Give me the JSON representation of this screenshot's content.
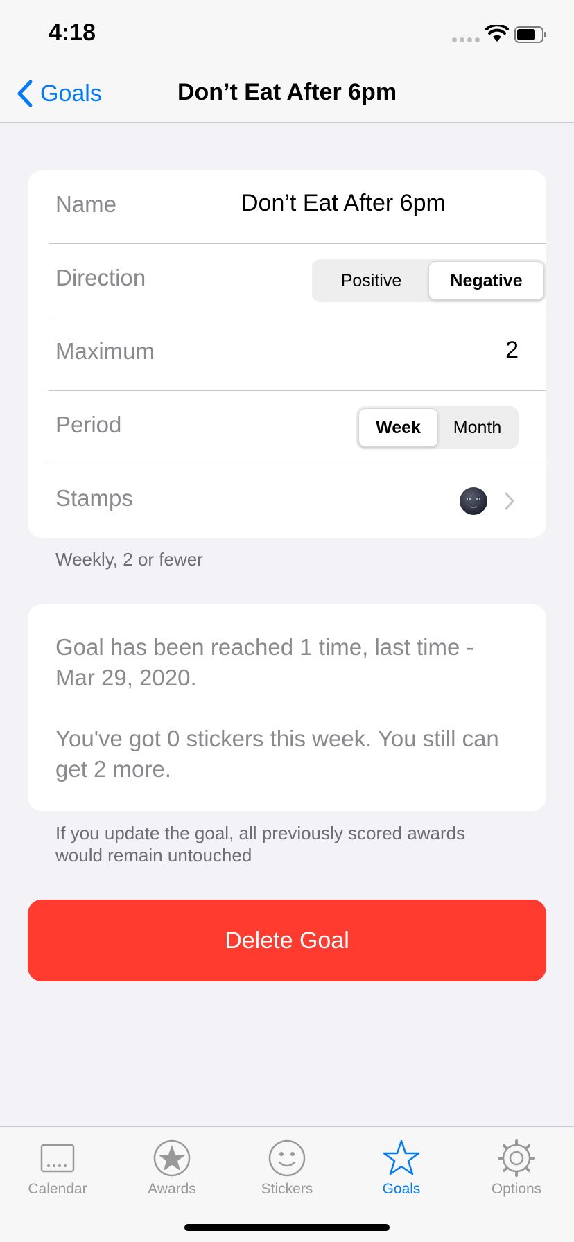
{
  "status": {
    "time": "4:18"
  },
  "nav": {
    "back_label": "Goals",
    "title": "Don’t Eat After 6pm"
  },
  "form": {
    "name_label": "Name",
    "name_value": "Don’t Eat After 6pm",
    "direction_label": "Direction",
    "direction_options": [
      "Positive",
      "Negative"
    ],
    "direction_selected": "Negative",
    "maximum_label": "Maximum",
    "maximum_value": "2",
    "period_label": "Period",
    "period_options": [
      "Week",
      "Month"
    ],
    "period_selected": "Week",
    "stamps_label": "Stamps",
    "stamp_icon": "new-moon-face-icon"
  },
  "form_footer": "Weekly, 2 or fewer",
  "info": {
    "reached": "Goal has been reached 1 time, last time - Mar 29, 2020.",
    "stickers": "You've got 0 stickers this week. You still can get 2 more."
  },
  "info_footer": "If you update the goal, all previously scored awards would remain untouched",
  "delete_label": "Delete Goal",
  "tabs": [
    {
      "label": "Calendar",
      "icon": "calendar-icon",
      "active": false
    },
    {
      "label": "Awards",
      "icon": "award-star-icon",
      "active": false
    },
    {
      "label": "Stickers",
      "icon": "smiley-icon",
      "active": false
    },
    {
      "label": "Goals",
      "icon": "star-outline-icon",
      "active": true
    },
    {
      "label": "Options",
      "icon": "gear-icon",
      "active": false
    }
  ],
  "colors": {
    "accent": "#007aff",
    "destructive": "#ff3b30",
    "background": "#f2f2f7"
  }
}
